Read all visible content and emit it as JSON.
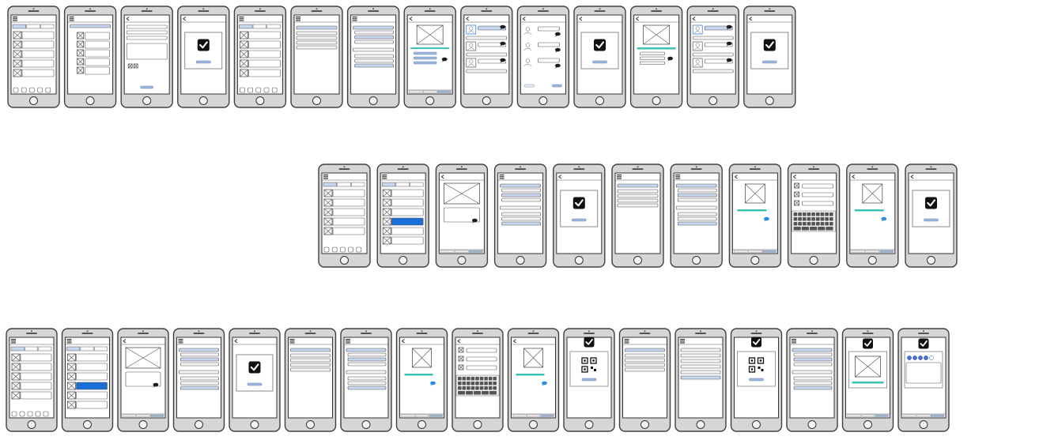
{
  "diagram": {
    "title": "",
    "colors": {
      "phone_body": "#d6d6d6",
      "phone_outline": "#404040",
      "screen_background": "#ffffff",
      "wireframe_line": "#555555",
      "wireframe_fill": "#e4e4e4",
      "selection_blue": "#1a6fd6",
      "list_highlight": "#c6d7ef",
      "progress_teal": "#3fc3b5",
      "speech_bubble": "#1c1c1c",
      "chat_bubble_blue": "#2a8be0",
      "check_box": "#111111"
    },
    "rows": [
      {
        "name": "row-1",
        "screens": [
          {
            "kind": "home-tabs"
          },
          {
            "kind": "list-expanded"
          },
          {
            "kind": "form"
          },
          {
            "kind": "confirmation"
          },
          {
            "kind": "home-tabs"
          },
          {
            "kind": "menu-list"
          },
          {
            "kind": "menu-list-long"
          },
          {
            "kind": "image-options"
          },
          {
            "kind": "contacts-chat"
          },
          {
            "kind": "contacts-chat-simple"
          },
          {
            "kind": "confirmation"
          },
          {
            "kind": "image-options-teal"
          },
          {
            "kind": "contacts-chat"
          },
          {
            "kind": "confirmation"
          }
        ]
      },
      {
        "name": "row-2",
        "screens": [
          {
            "kind": "home-tabs"
          },
          {
            "kind": "list-selected"
          },
          {
            "kind": "image-large"
          },
          {
            "kind": "menu-list-long"
          },
          {
            "kind": "confirmation"
          },
          {
            "kind": "menu-list"
          },
          {
            "kind": "menu-list-long"
          },
          {
            "kind": "image-progress"
          },
          {
            "kind": "keyboard-form"
          },
          {
            "kind": "image-progress"
          },
          {
            "kind": "confirmation"
          }
        ]
      },
      {
        "name": "row-3",
        "screens": [
          {
            "kind": "home-tabs"
          },
          {
            "kind": "list-selected"
          },
          {
            "kind": "image-large"
          },
          {
            "kind": "menu-list-long"
          },
          {
            "kind": "confirmation"
          },
          {
            "kind": "menu-list"
          },
          {
            "kind": "menu-list-long"
          },
          {
            "kind": "image-progress"
          },
          {
            "kind": "keyboard-form"
          },
          {
            "kind": "image-progress"
          },
          {
            "kind": "qr-confirm"
          },
          {
            "kind": "menu-list"
          },
          {
            "kind": "menu-list-short"
          },
          {
            "kind": "qr-confirm"
          },
          {
            "kind": "menu-list-long"
          },
          {
            "kind": "check-image"
          },
          {
            "kind": "check-dots"
          }
        ]
      }
    ]
  }
}
